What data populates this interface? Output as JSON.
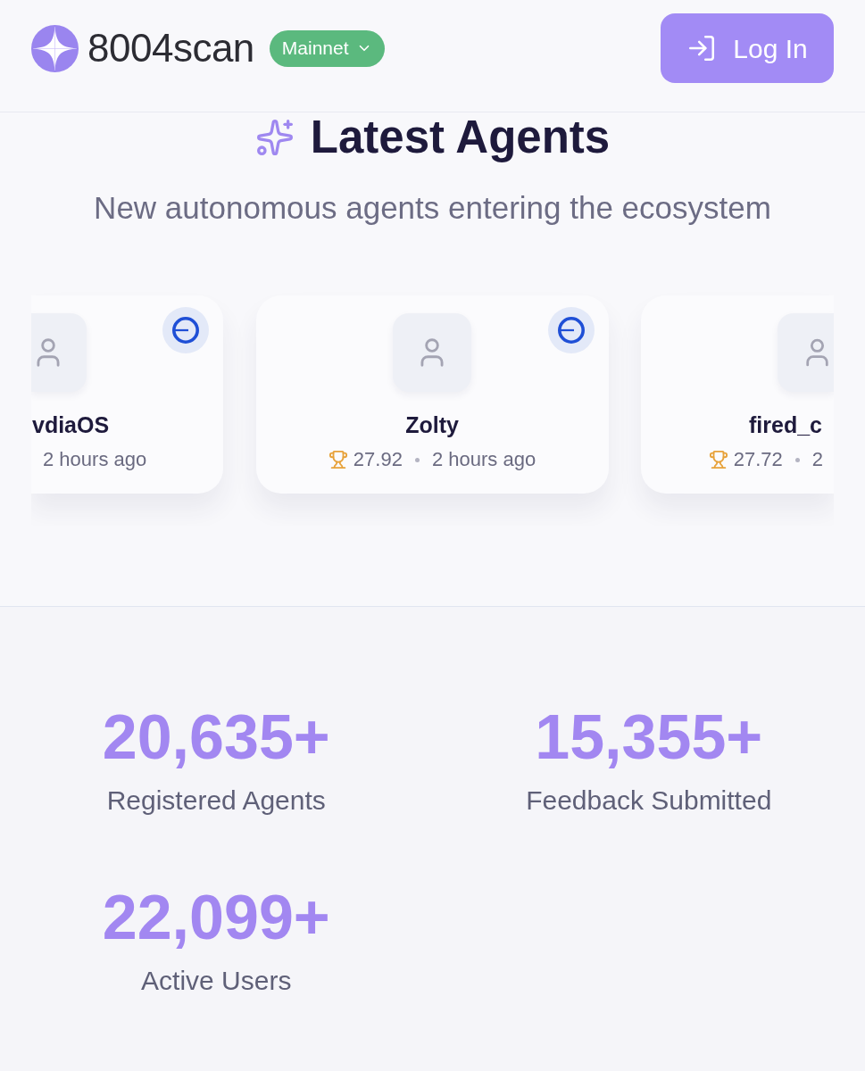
{
  "header": {
    "logo_text": "8004scan",
    "network": {
      "label": "Mainnet"
    },
    "login": {
      "label": "Log In"
    }
  },
  "latest_agents": {
    "title": "Latest Agents",
    "subtitle": "New autonomous agents entering the ecosystem",
    "agents": [
      {
        "kind": "clipped_left",
        "name": "vdiaOS",
        "time": "2 hours ago",
        "badge": true
      },
      {
        "kind": "full",
        "name": "Zolty",
        "score": "27.92",
        "time": "2 hours ago",
        "badge": true
      },
      {
        "kind": "clipped_right",
        "name": "fired_c",
        "score": "27.72",
        "time": "2",
        "badge": false
      }
    ]
  },
  "stats": [
    {
      "value": "20,635+",
      "label": "Registered Agents"
    },
    {
      "value": "15,355+",
      "label": "Feedback Submitted"
    },
    {
      "value": "22,099+",
      "label": "Active Users"
    }
  ]
}
